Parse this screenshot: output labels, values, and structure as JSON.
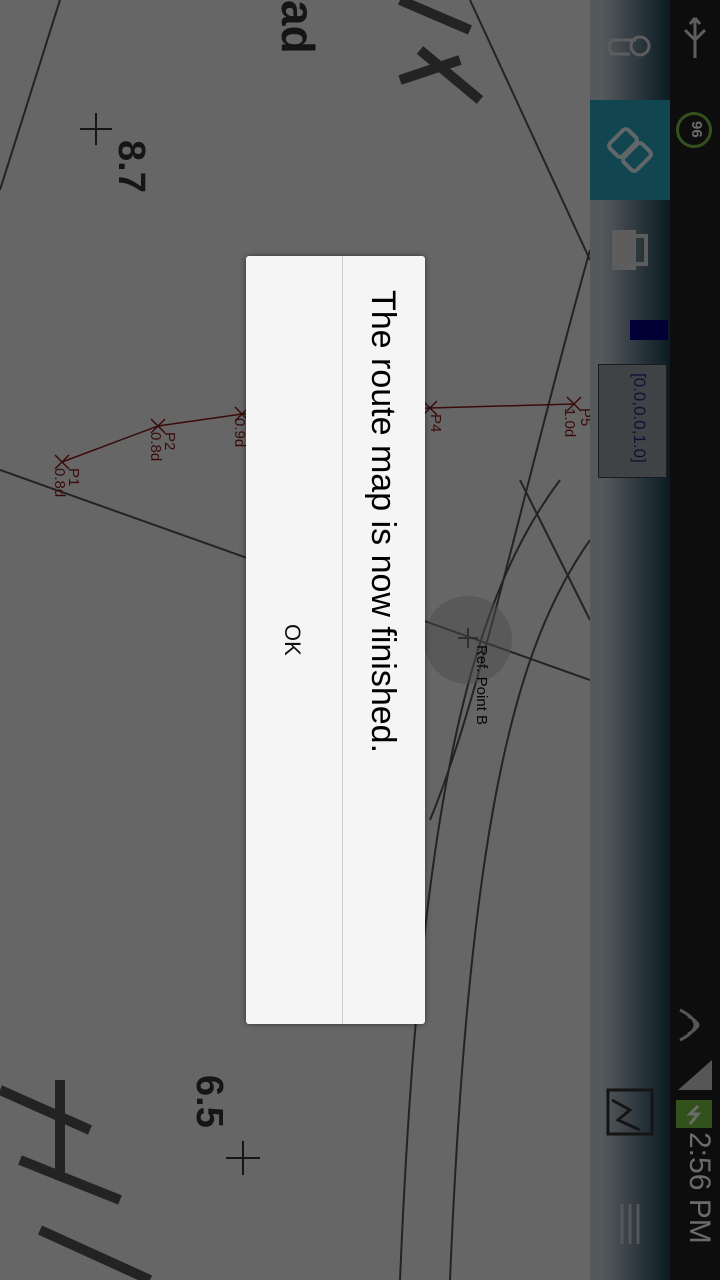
{
  "dialog": {
    "message": "The route map is now finished.",
    "ok_label": "OK"
  },
  "status_bar": {
    "time": "2:56 PM",
    "notification_count": "96",
    "icons": [
      "usb-icon",
      "notification-badge",
      "wifi-icon",
      "signal-icon",
      "battery-charging-icon"
    ]
  },
  "toolbar": {
    "coordinates": "[0.0,0.0,1.0]",
    "icons": [
      "touch-icon",
      "link-icon",
      "lock-icon",
      "image-icon",
      "menu-icon"
    ],
    "accent_color": "#2aa8c0"
  },
  "map": {
    "labels": {
      "val_top": "8.7",
      "val_bottom": "6.5",
      "top_left_text": "ad",
      "p1": "P1",
      "p1_depth": "0.8d",
      "p2": "P2",
      "p2_depth": "0.8d",
      "p3_depth": "0.9d",
      "p4": "P4",
      "p5": "P5",
      "p5_depth": "1.0d",
      "ref_point": "Ref. Point B"
    }
  }
}
